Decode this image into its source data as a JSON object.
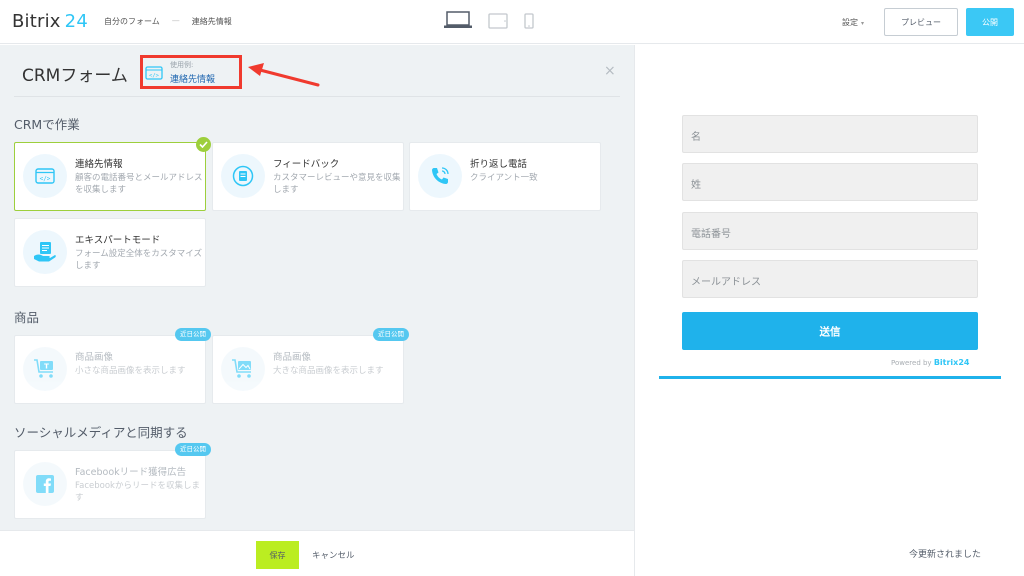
{
  "header": {
    "logo_main": "Bitrix",
    "logo_num": "24",
    "breadcrumb": [
      "自分のフォーム",
      "—",
      "連絡先情報"
    ],
    "devices": [
      "laptop-icon",
      "tablet-icon",
      "phone-icon"
    ],
    "settings_label": "設定",
    "preview_label": "プレビュー",
    "publish_label": "公開"
  },
  "panel": {
    "title": "CRMフォーム",
    "usage_small": "使用例:",
    "usage_value": "連絡先情報",
    "close": "×"
  },
  "sections": {
    "crm": "CRMで作業",
    "products": "商品",
    "social": "ソーシャルメディアと同期する"
  },
  "cards": {
    "contact": {
      "title": "連絡先情報",
      "desc": "顧客の電話番号とメールアドレスを収集します"
    },
    "feedback": {
      "title": "フィードバック",
      "desc": "カスタマーレビューや意見を収集します"
    },
    "callback": {
      "title": "折り返し電話",
      "desc": "クライアント一致"
    },
    "expert": {
      "title": "エキスパートモード",
      "desc": "フォーム設定全体をカスタマイズします"
    },
    "product_small": {
      "title": "商品画像",
      "desc": "小さな商品画像を表示します",
      "badge": "近日公開"
    },
    "product_large": {
      "title": "商品画像",
      "desc": "大きな商品画像を表示します",
      "badge": "近日公開"
    },
    "facebook": {
      "title": "Facebookリード獲得広告",
      "desc": "Facebookからリードを収集します",
      "badge": "近日公開"
    }
  },
  "footer": {
    "save_label": "保存",
    "cancel_label": "キャンセル"
  },
  "preview": {
    "fields": [
      "名",
      "姓",
      "電話番号",
      "メールアドレス"
    ],
    "submit_label": "送信",
    "powered_by": "Powered by",
    "powered_brand": "Bitrix",
    "powered_num": "24",
    "updated": "今更新されました"
  },
  "colors": {
    "accent": "#2fc6f6",
    "save": "#bbed21",
    "highlight": "#f03a2e",
    "selected": "#9dcf3c"
  }
}
